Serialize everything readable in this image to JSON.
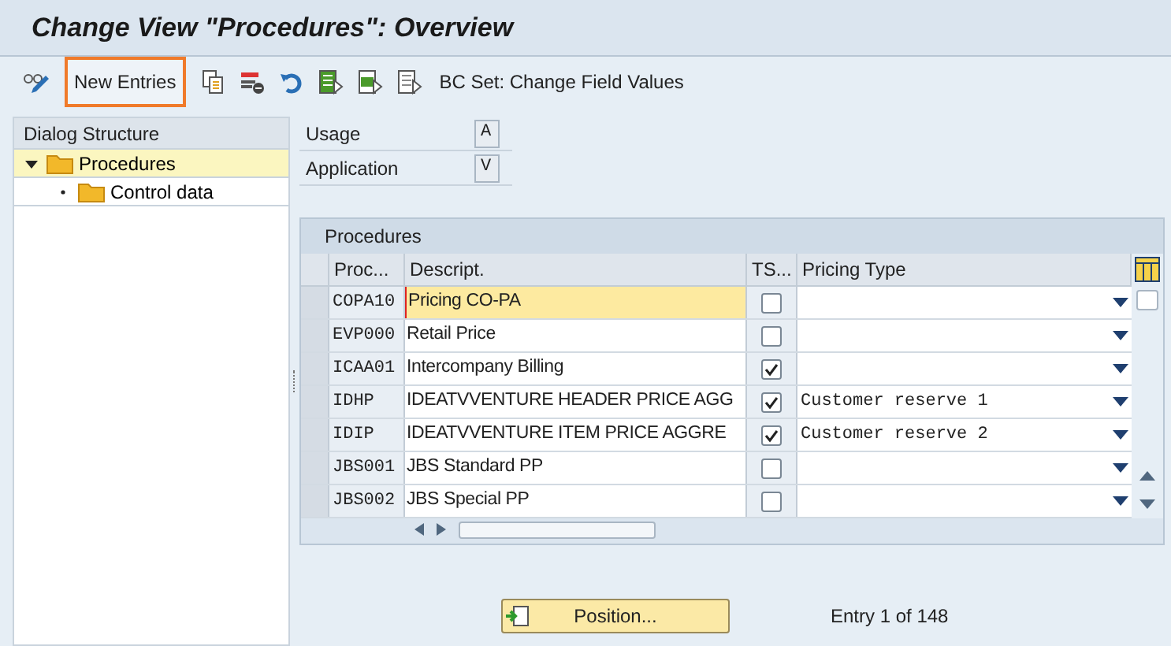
{
  "window": {
    "title": "Change View \"Procedures\": Overview"
  },
  "toolbar": {
    "items": [
      {
        "kind": "icon"
      },
      {
        "kind": "text",
        "label": "New Entries",
        "highlighted": true
      },
      {
        "kind": "icon"
      },
      {
        "kind": "icon"
      },
      {
        "kind": "icon"
      },
      {
        "kind": "icon"
      },
      {
        "kind": "icon"
      },
      {
        "kind": "icon"
      },
      {
        "kind": "text",
        "label": "BC Set: Change Field Values",
        "highlighted": false
      }
    ]
  },
  "dialog_structure": {
    "title": "Dialog Structure",
    "items": [
      {
        "label": "Procedures",
        "expanded": true,
        "selected": true,
        "children": [
          {
            "label": "Control data",
            "selected": false
          }
        ]
      }
    ]
  },
  "fields": [
    {
      "label": "Usage",
      "value": "A"
    },
    {
      "label": "Application",
      "value": "V"
    }
  ],
  "table": {
    "title": "Procedures",
    "columns": [
      "Proc...",
      "Descript.",
      "TS...",
      "Pricing Type"
    ],
    "rows": [
      {
        "proc": "COPA10",
        "descript": "Pricing CO-PA",
        "ts": false,
        "pricing_type": "",
        "selected": true
      },
      {
        "proc": "EVP000",
        "descript": "Retail Price",
        "ts": false,
        "pricing_type": "",
        "selected": false
      },
      {
        "proc": "ICAA01",
        "descript": "Intercompany Billing",
        "ts": true,
        "pricing_type": "",
        "selected": false
      },
      {
        "proc": "IDHP",
        "descript": "IDEATVVENTURE HEADER PRICE AGG",
        "ts": true,
        "pricing_type": "Customer reserve 1",
        "selected": false
      },
      {
        "proc": "IDIP",
        "descript": "IDEATVVENTURE ITEM PRICE AGGRE",
        "ts": true,
        "pricing_type": "Customer reserve 2",
        "selected": false
      },
      {
        "proc": "JBS001",
        "descript": "JBS Standard PP",
        "ts": false,
        "pricing_type": "",
        "selected": false
      },
      {
        "proc": "JBS002",
        "descript": "JBS Special PP",
        "ts": false,
        "pricing_type": "",
        "selected": false
      }
    ]
  },
  "position_button": "Position...",
  "entry_info": "Entry 1 of 148"
}
